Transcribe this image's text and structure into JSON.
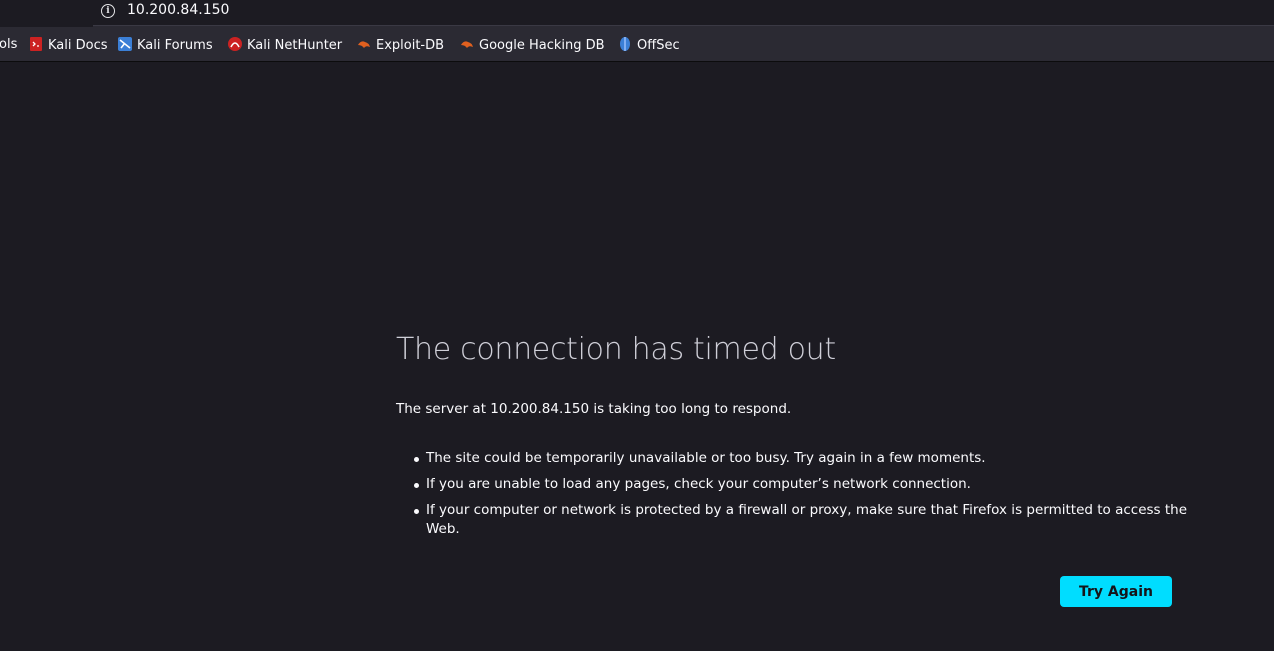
{
  "address_bar": {
    "url": "10.200.84.150"
  },
  "bookmarks": [
    {
      "label": "ols",
      "icon": "truncated-bookmark"
    },
    {
      "label": "Kali Docs",
      "icon": "kali-docs-icon",
      "color": "#cc2222"
    },
    {
      "label": "Kali Forums",
      "icon": "kali-forums-icon",
      "color": "#3b7fd6"
    },
    {
      "label": "Kali NetHunter",
      "icon": "kali-nethunter-icon",
      "color": "#cc2222"
    },
    {
      "label": "Exploit-DB",
      "icon": "exploit-db-icon",
      "color": "#e0601f"
    },
    {
      "label": "Google Hacking DB",
      "icon": "ghdb-icon",
      "color": "#e0601f"
    },
    {
      "label": "OffSec",
      "icon": "offsec-icon",
      "color": "#3b7fd6"
    }
  ],
  "error": {
    "title": "The connection has timed out",
    "lead": "The server at 10.200.84.150 is taking too long to respond.",
    "tips": [
      "The site could be temporarily unavailable or too busy. Try again in a few moments.",
      "If you are unable to load any pages, check your computer’s network connection.",
      "If your computer or network is protected by a firewall or proxy, make sure that Firefox is permitted to access the Web."
    ],
    "button_label": "Try Again"
  },
  "colors": {
    "page_bg": "#1c1b22",
    "toolbar_bg": "#2b2a33",
    "accent": "#00ddff"
  }
}
